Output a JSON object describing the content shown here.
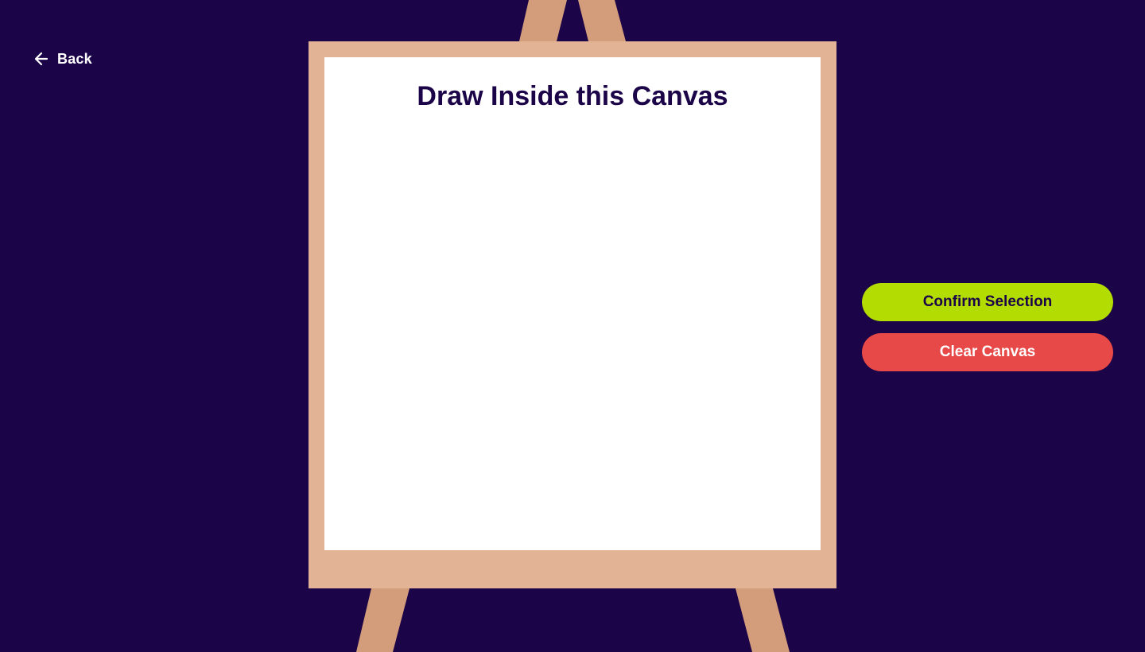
{
  "nav": {
    "back_label": "Back",
    "back_icon": "arrow-left-icon"
  },
  "canvas": {
    "title": "Draw Inside this Canvas"
  },
  "actions": {
    "confirm_label": "Confirm Selection",
    "clear_label": "Clear Canvas"
  },
  "colors": {
    "background": "#1b0447",
    "easel_wood": "#d39d7b",
    "easel_board": "#e2b394",
    "canvas": "#ffffff",
    "title_text": "#1b0447",
    "confirm_button": "#b2dc02",
    "clear_button": "#e74848"
  }
}
